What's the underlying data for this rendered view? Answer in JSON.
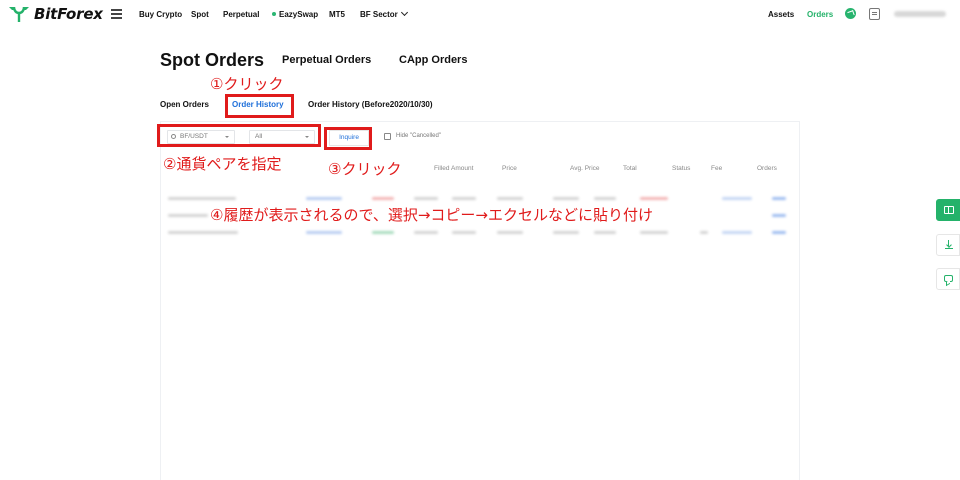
{
  "app": {
    "name": "BitForex"
  },
  "nav": {
    "items": [
      "Buy Crypto",
      "Spot",
      "Perpetual",
      "EazySwap",
      "MT5",
      "BF Sector"
    ],
    "right": {
      "assets": "Assets",
      "orders": "Orders"
    },
    "accent_color": "#2bb673"
  },
  "page": {
    "title": "Spot Orders",
    "tabs": [
      "Perpetual Orders",
      "CApp Orders"
    ],
    "subtabs": [
      "Open Orders",
      "Order History",
      "Order History (Before2020/10/30)"
    ],
    "active_subtab": "Order History",
    "active_color": "#1e6fd9"
  },
  "filters": {
    "pair": "BF/USDT",
    "type": "All",
    "inquire": "Inquire",
    "hide_cancelled": "Hide \"Cancelled\""
  },
  "table": {
    "columns": [
      "Filled Amount",
      "Price",
      "Avg. Price",
      "Total",
      "Status",
      "Fee",
      "Orders"
    ]
  },
  "annotations": {
    "a1": "①クリック",
    "a2": "②通貨ペアを指定",
    "a3": "③クリック",
    "a4": "④履歴が表示されるので、選択→コピー→エクセルなどに貼り付け",
    "color": "#e01b1b"
  },
  "side_icons": [
    "book-icon",
    "download-icon",
    "chat-icon"
  ]
}
